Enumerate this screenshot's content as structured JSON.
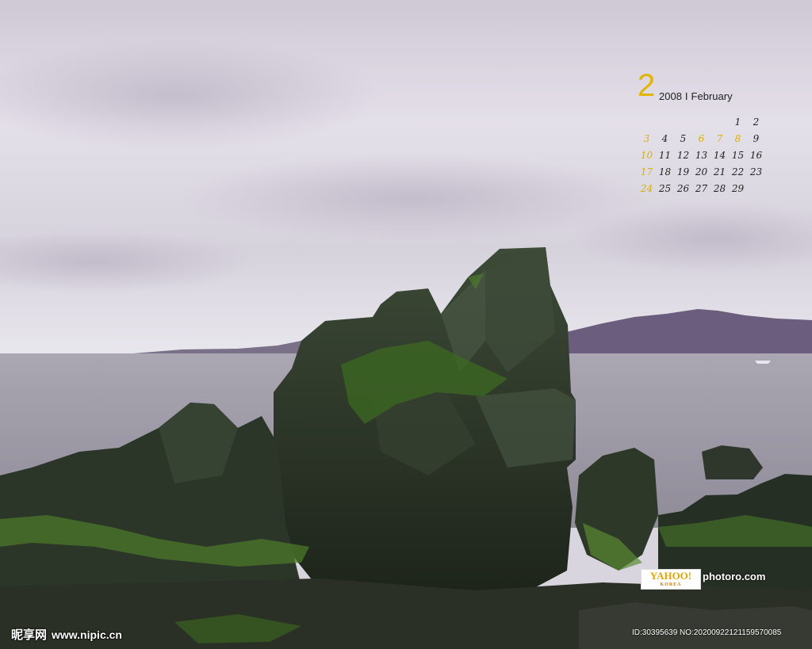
{
  "calendar": {
    "month_number": "2",
    "year": "2008",
    "separator": "I",
    "month_name": "February",
    "days": [
      [
        "",
        "",
        "",
        "",
        "",
        "1",
        "2"
      ],
      [
        "3",
        "4",
        "5",
        "6",
        "7",
        "8",
        "9"
      ],
      [
        "10",
        "11",
        "12",
        "13",
        "14",
        "15",
        "16"
      ],
      [
        "17",
        "18",
        "19",
        "20",
        "21",
        "22",
        "23"
      ],
      [
        "24",
        "25",
        "26",
        "27",
        "28",
        "29",
        ""
      ]
    ],
    "highlighted_days": [
      "6",
      "7",
      "8"
    ],
    "accent_color": "#e2b400"
  },
  "watermarks": {
    "yahoo_logo": "YAHOO!",
    "yahoo_sub": "KOREA",
    "photoro": "photoro.com",
    "nipic_brand": "昵享网",
    "nipic_url": "www.nipic.cn",
    "image_id": "ID:30395639 NO:20200922121159570085"
  },
  "colors": {
    "sky": "#dcd8e2",
    "sea": "#9e9aa6",
    "mountain": "#6e5f80",
    "rock": "#2f3a2c",
    "moss": "#5e8a2e"
  }
}
